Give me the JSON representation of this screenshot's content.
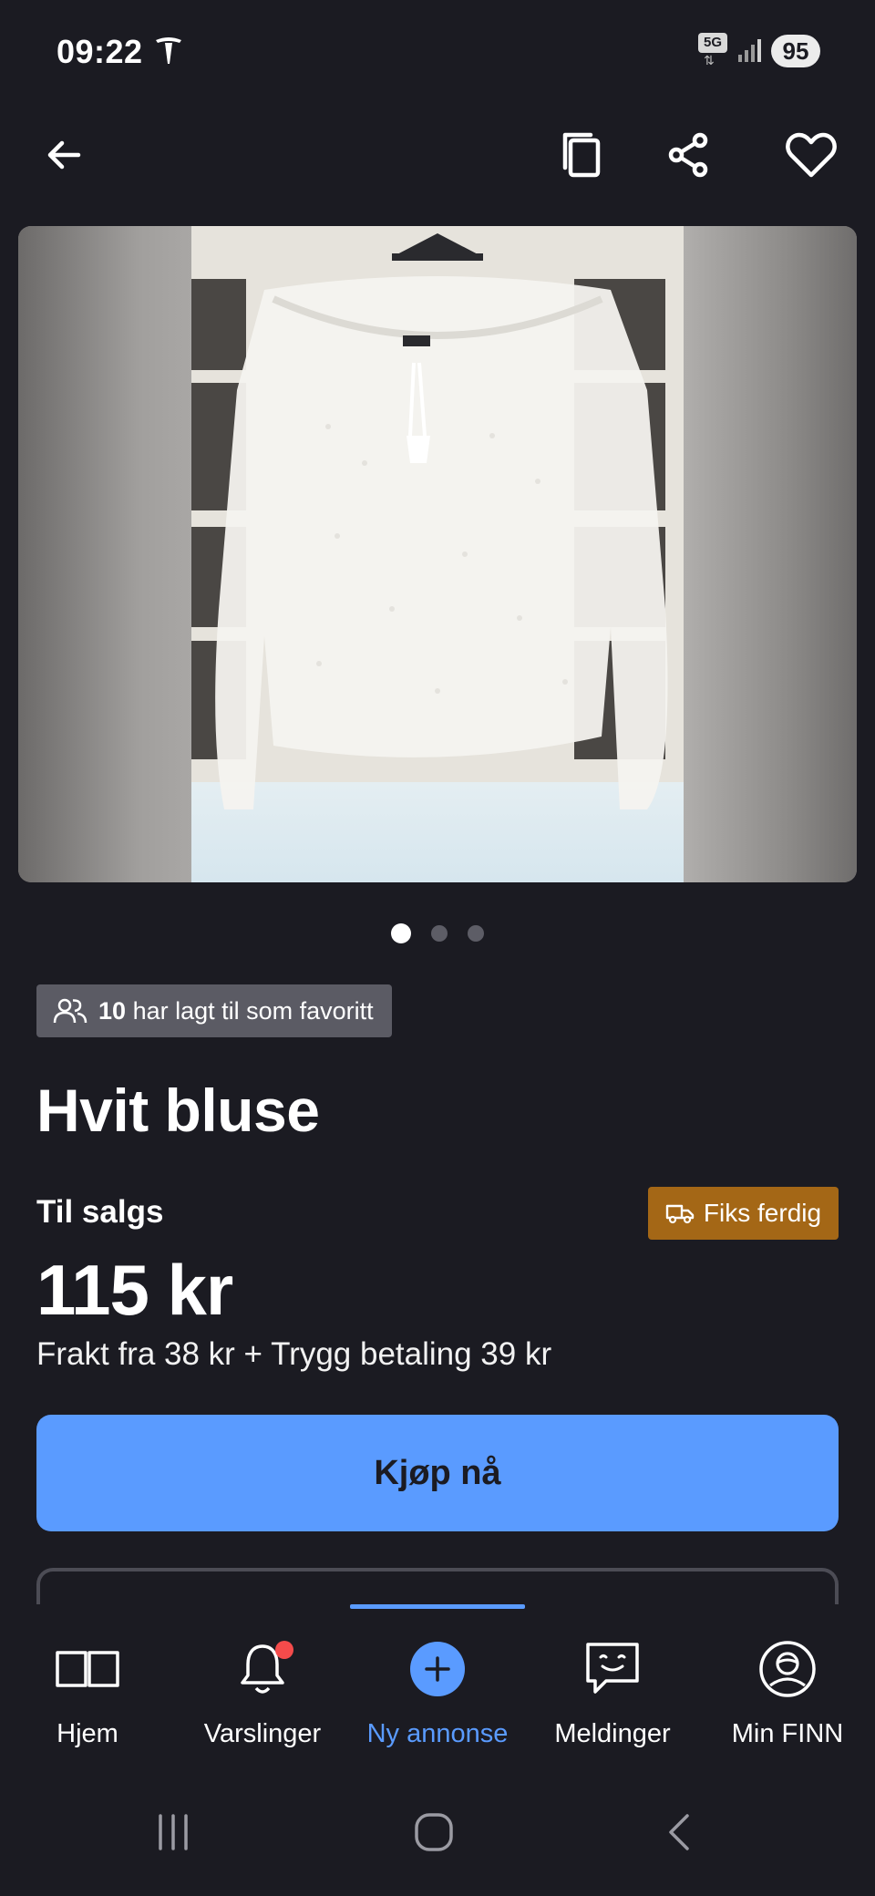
{
  "status_bar": {
    "time": "09:22",
    "network": "5G",
    "battery": "95"
  },
  "topnav": {
    "icons": [
      "back-arrow-icon",
      "copy-icon",
      "share-icon",
      "heart-icon"
    ]
  },
  "gallery": {
    "total_images": 3,
    "active_index": 0
  },
  "listing": {
    "favorites_count": "10",
    "favorites_text": "har lagt til som favoritt",
    "title": "Hvit bluse",
    "sale_label": "Til salgs",
    "fiks_ferdig_label": "Fiks ferdig",
    "price": "115 kr",
    "shipping_text": "Frakt fra 38 kr + Trygg betaling 39 kr",
    "buy_button_label": "Kjøp nå"
  },
  "bottom_nav": {
    "items": [
      {
        "label": "Hjem",
        "icon": "book-icon",
        "active": false
      },
      {
        "label": "Varslinger",
        "icon": "bell-icon",
        "active": false,
        "has_notification": true
      },
      {
        "label": "Ny annonse",
        "icon": "plus-circle-icon",
        "active": true
      },
      {
        "label": "Meldinger",
        "icon": "chat-icon",
        "active": false
      },
      {
        "label": "Min FINN",
        "icon": "profile-icon",
        "active": false
      }
    ]
  },
  "colors": {
    "background": "#1b1b22",
    "accent": "#5a9bff",
    "fiks_badge": "#a46716",
    "fav_badge": "#5b5b64",
    "notification": "#f44b4b"
  }
}
